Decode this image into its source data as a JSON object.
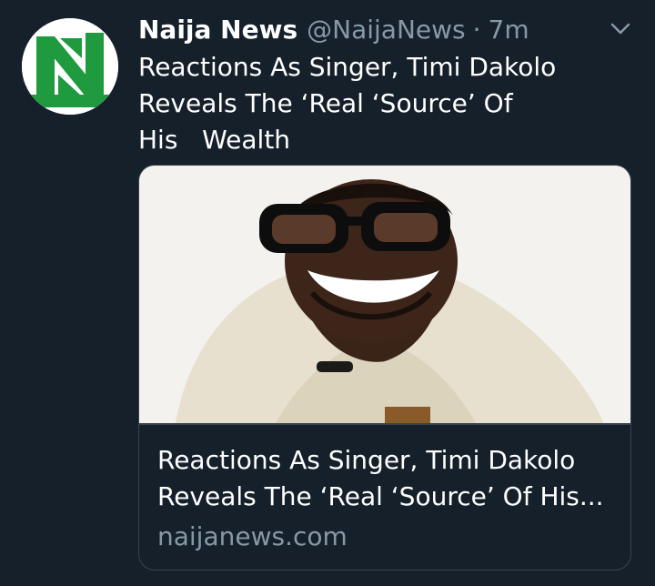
{
  "tweet": {
    "author": {
      "display_name": "Naija News",
      "handle": "@NaijaNews",
      "avatar_logo_text": "NaijaNews"
    },
    "separator": "·",
    "time": "7m",
    "text": "Reactions As Singer, Timi Dakolo\nReveals The ‘Real ‘Source’ Of\nHis   Wealth",
    "caret_icon": "chevron-down-icon"
  },
  "card": {
    "title_line_1": "Reactions As Singer, Timi Dakolo",
    "title_line_2": "Reveals The ‘Real ‘Source’ Of His...",
    "domain": "naijanews.com"
  },
  "colors": {
    "background": "#15202b",
    "secondary_text": "#8899a6",
    "border": "#38444d",
    "brand_green": "#1f9a3e"
  }
}
